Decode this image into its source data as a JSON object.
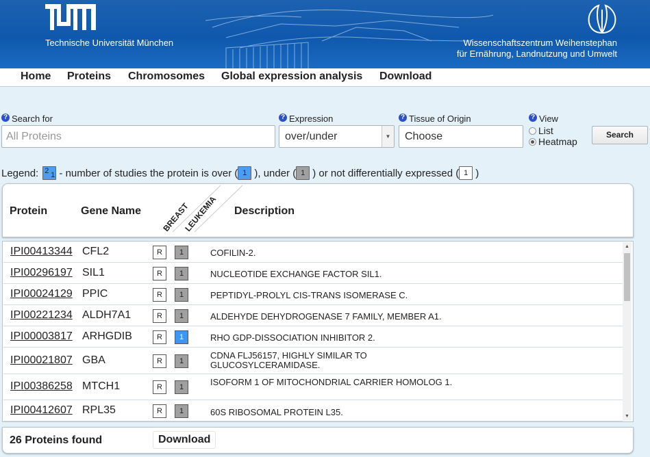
{
  "header": {
    "left_name": "Technische Universität München",
    "right_name_line1": "Wissenschaftszentrum Weihenstephan",
    "right_name_line2": "für Ernährung, Landnutzung und Umwelt",
    "icons": [
      "tum-logo-icon",
      "wzw-logo-icon"
    ]
  },
  "nav": {
    "items": [
      {
        "label": "Home"
      },
      {
        "label": "Proteins"
      },
      {
        "label": "Chromosomes"
      },
      {
        "label": "Global expression analysis"
      },
      {
        "label": "Download"
      }
    ]
  },
  "search": {
    "search_for_label": "Search for",
    "search_placeholder": "All Proteins",
    "expression_label": "Expression",
    "expression_value": "over/under",
    "tissue_label": "Tissue of Origin",
    "tissue_value": "Choose",
    "view_label": "View",
    "view_options": [
      {
        "label": "List",
        "checked": false
      },
      {
        "label": "Heatmap",
        "checked": true
      }
    ],
    "search_button": "Search",
    "help_glyph": "?"
  },
  "legend": {
    "prefix": "Legend:",
    "sample_over": "2",
    "sample_under": "1",
    "text1": " - number of studies the protein is over (",
    "over_value": "1",
    "text2": "), under (",
    "under_value": "1",
    "text3": ") or not differentially expressed (",
    "none_value": "1",
    "text4": ")",
    "colors": {
      "over": "#4d9cf3",
      "under": "#a0a0a0",
      "none": "#ffffff"
    }
  },
  "table": {
    "headers": {
      "protein": "Protein",
      "gene": "Gene Name",
      "tissue1": "BREAST",
      "tissue2": "LEUKEMIA",
      "description": "Description"
    },
    "rows": [
      {
        "id": "IPI00413344",
        "gene": "CFL2",
        "breast": "R",
        "leukemia": "1",
        "leukemia_state": "under",
        "desc": "COFILIN-2."
      },
      {
        "id": "IPI00296197",
        "gene": "SIL1",
        "breast": "R",
        "leukemia": "1",
        "leukemia_state": "under",
        "desc": "NUCLEOTIDE EXCHANGE FACTOR SIL1."
      },
      {
        "id": "IPI00024129",
        "gene": "PPIC",
        "breast": "R",
        "leukemia": "1",
        "leukemia_state": "under",
        "desc": "PEPTIDYL-PROLYL CIS-TRANS ISOMERASE C."
      },
      {
        "id": "IPI00221234",
        "gene": "ALDH7A1",
        "breast": "R",
        "leukemia": "1",
        "leukemia_state": "under",
        "desc": "ALDEHYDE DEHYDROGENASE 7 FAMILY, MEMBER A1."
      },
      {
        "id": "IPI00003817",
        "gene": "ARHGDIB",
        "breast": "R",
        "leukemia": "1",
        "leukemia_state": "over",
        "desc": "RHO GDP-DISSOCIATION INHIBITOR 2."
      },
      {
        "id": "IPI00021807",
        "gene": "GBA",
        "breast": "R",
        "leukemia": "1",
        "leukemia_state": "under",
        "desc": "CDNA FLJ56157, HIGHLY SIMILAR TO GLUCOSYLCERAMIDASE."
      },
      {
        "id": "IPI00386258",
        "gene": "MTCH1",
        "breast": "R",
        "leukemia": "1",
        "leukemia_state": "under",
        "desc": "ISOFORM 1 OF MITOCHONDRIAL CARRIER HOMOLOG 1."
      },
      {
        "id": "IPI00412607",
        "gene": "RPL35",
        "breast": "R",
        "leukemia": "1",
        "leukemia_state": "under",
        "desc": "60S RIBOSOMAL PROTEIN L35."
      }
    ]
  },
  "footer": {
    "found_text": "26 Proteins found",
    "download_label": "Download"
  }
}
